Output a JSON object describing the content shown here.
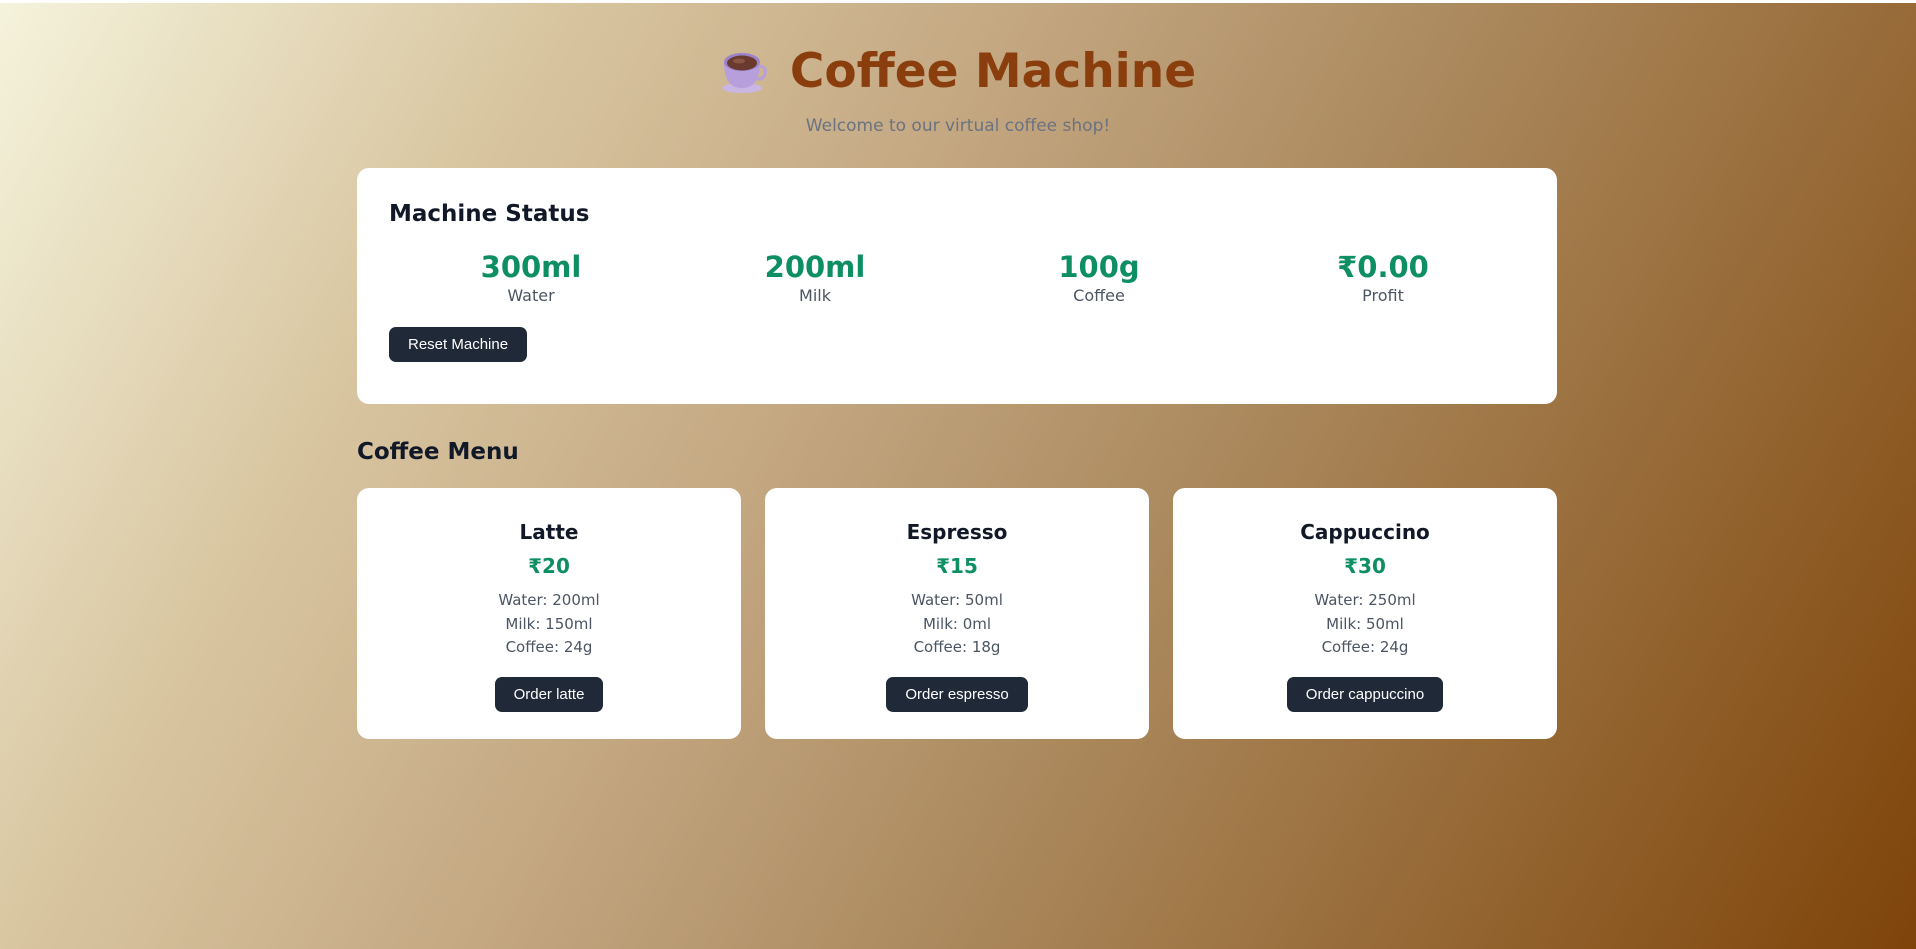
{
  "header": {
    "icon": "coffee-cup-icon",
    "title": "Coffee Machine",
    "subtitle": "Welcome to our virtual coffee shop!"
  },
  "status": {
    "title": "Machine Status",
    "stats": [
      {
        "value": "300ml",
        "label": "Water"
      },
      {
        "value": "200ml",
        "label": "Milk"
      },
      {
        "value": "100g",
        "label": "Coffee"
      },
      {
        "value": "₹0.00",
        "label": "Profit"
      }
    ],
    "reset_label": "Reset Machine"
  },
  "menu": {
    "title": "Coffee Menu",
    "items": [
      {
        "name": "Latte",
        "price": "₹20",
        "water": "Water: 200ml",
        "milk": "Milk: 150ml",
        "coffee": "Coffee: 24g",
        "button": "Order latte"
      },
      {
        "name": "Espresso",
        "price": "₹15",
        "water": "Water: 50ml",
        "milk": "Milk: 0ml",
        "coffee": "Coffee: 18g",
        "button": "Order espresso"
      },
      {
        "name": "Cappuccino",
        "price": "₹30",
        "water": "Water: 250ml",
        "milk": "Milk: 50ml",
        "coffee": "Coffee: 24g",
        "button": "Order cappuccino"
      }
    ]
  },
  "colors": {
    "title": "#8a3e0d",
    "accent_green": "#0e8f63",
    "button_bg": "#1f2937"
  }
}
